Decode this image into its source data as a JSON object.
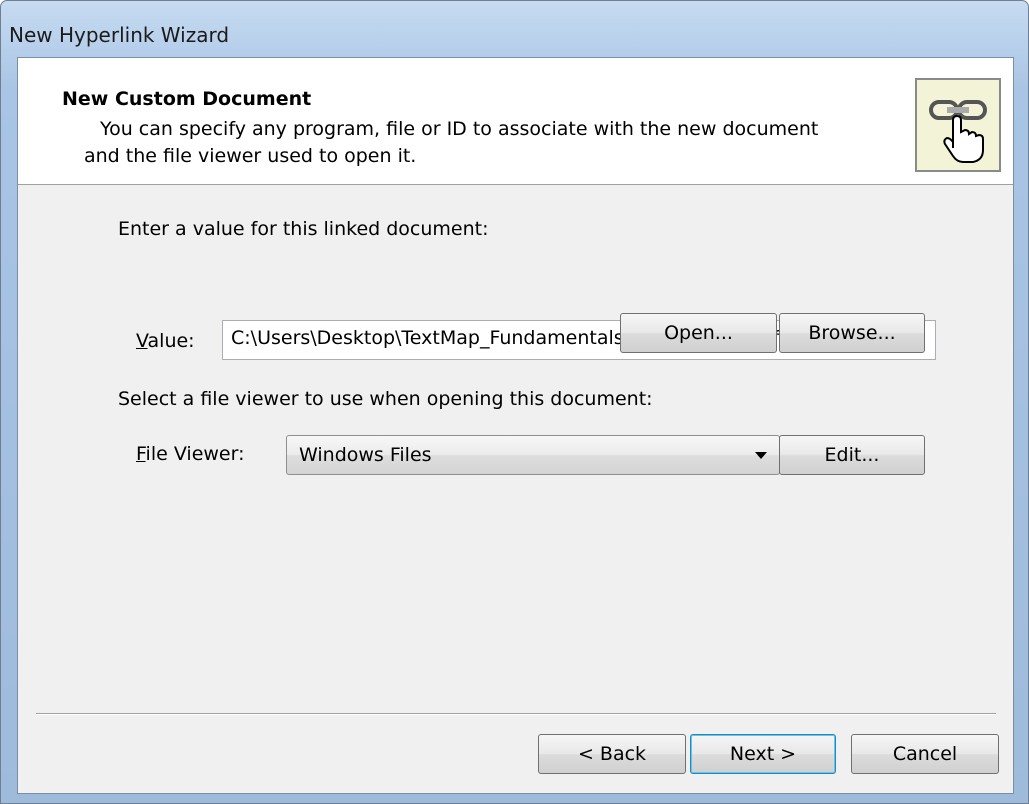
{
  "window": {
    "title": "New Hyperlink Wizard"
  },
  "header": {
    "title": "New Custom Document",
    "description_line1": "You can specify any program, file or ID to associate with the new document",
    "description_line2": "and the file viewer used to open it.",
    "icon": "hyperlink-hand-icon"
  },
  "value_section": {
    "prompt": "Enter a value for this linked document:",
    "label_mnemonic": "V",
    "label_rest": "alue:",
    "value": "C:\\Users\\Desktop\\TextMap_Fundamentals_Training\\Plaintiff Plaintiff",
    "open_label": "Open...",
    "browse_label": "Browse..."
  },
  "viewer_section": {
    "prompt": "Select a file viewer to use when opening this document:",
    "label_mnemonic": "F",
    "label_rest": "ile Viewer:",
    "selected": "Windows Files",
    "edit_label": "Edit..."
  },
  "footer": {
    "back_label": "< Back",
    "next_label": "Next >",
    "cancel_label": "Cancel"
  }
}
